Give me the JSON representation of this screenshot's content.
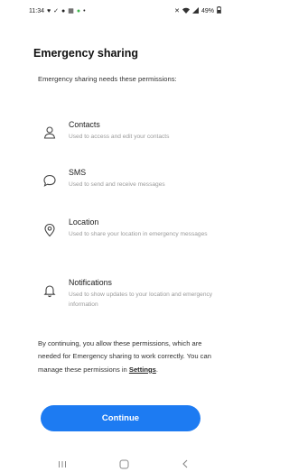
{
  "status_bar": {
    "time": "11:34",
    "battery": "49%"
  },
  "page": {
    "title": "Emergency sharing",
    "intro": "Emergency sharing needs these permissions:"
  },
  "permissions": [
    {
      "name": "Contacts",
      "description": "Used to access and edit your contacts",
      "icon": "person-icon"
    },
    {
      "name": "SMS",
      "description": "Used to send and receive messages",
      "icon": "chat-bubble-icon"
    },
    {
      "name": "Location",
      "description": "Used to share your location in emergency messages",
      "icon": "location-pin-icon"
    },
    {
      "name": "Notifications",
      "description": "Used to show updates to your location and emergency information",
      "icon": "bell-icon"
    }
  ],
  "footer": {
    "text_before_link": "By continuing, you allow these permissions, which are needed for Emergency sharing to work correctly. You can manage these permissions in ",
    "link_text": "Settings",
    "text_after_link": "."
  },
  "continue_button": {
    "label": "Continue",
    "color": "#1d7bf2"
  },
  "nav": {
    "recents_icon": "recents-icon",
    "home_icon": "home-icon",
    "back_icon": "back-icon"
  }
}
